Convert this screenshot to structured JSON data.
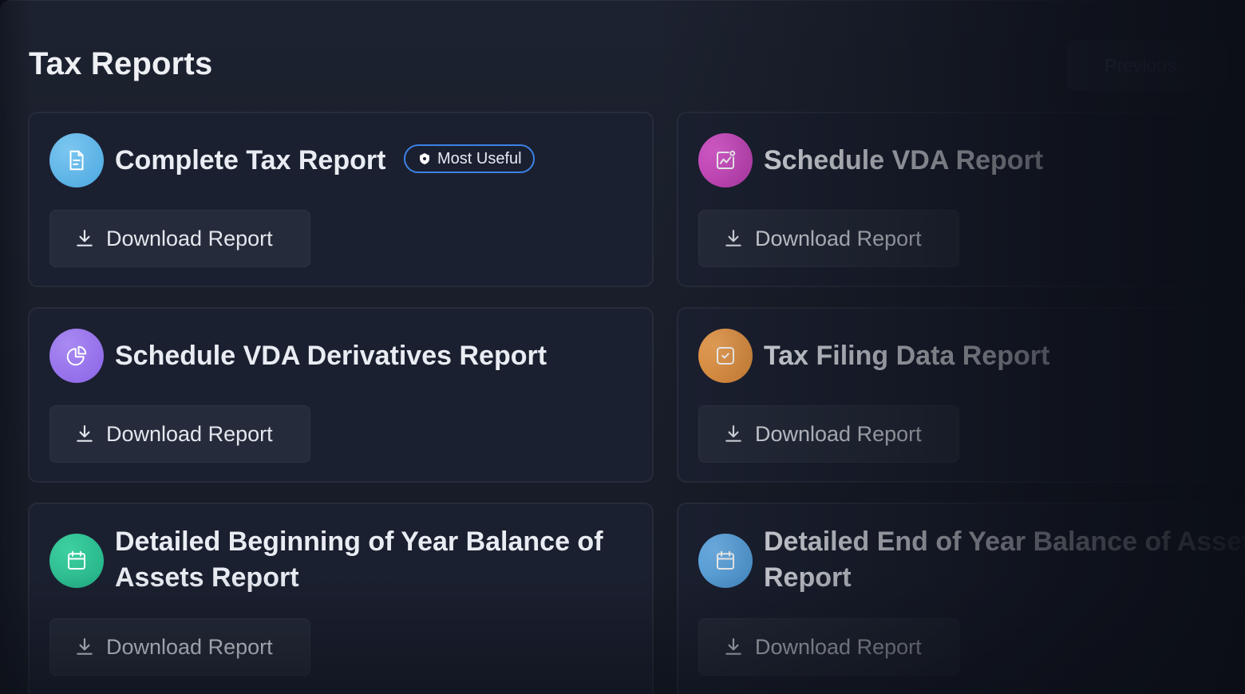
{
  "page": {
    "title": "Tax Reports",
    "previous_label": "Previous"
  },
  "badge": {
    "label": "Most Useful",
    "color": "#3d82e6"
  },
  "reports": [
    {
      "title": "Complete Tax Report",
      "icon": "document-icon",
      "color": "#4aa8e0",
      "button": "Download Report"
    },
    {
      "title": "Schedule VDA Report",
      "icon": "chart-icon",
      "color": "#c23bb5",
      "button": "Download Report"
    },
    {
      "title": "Schedule VDA Derivatives Report",
      "icon": "pie-chart-icon",
      "color": "#8a63e6",
      "button": "Download Report"
    },
    {
      "title": "Tax Filing Data Report",
      "icon": "checkbox-icon",
      "color": "#e08a35",
      "button": "Download Report"
    },
    {
      "title": "Detailed Beginning of Year Balance of Assets Report",
      "icon": "calendar-icon",
      "color": "#1fae82",
      "button": "Download Report"
    },
    {
      "title": "Detailed End of Year Balance of Assets Report",
      "icon": "calendar-icon",
      "color": "#4c9ee0",
      "button": "Download Report"
    }
  ]
}
